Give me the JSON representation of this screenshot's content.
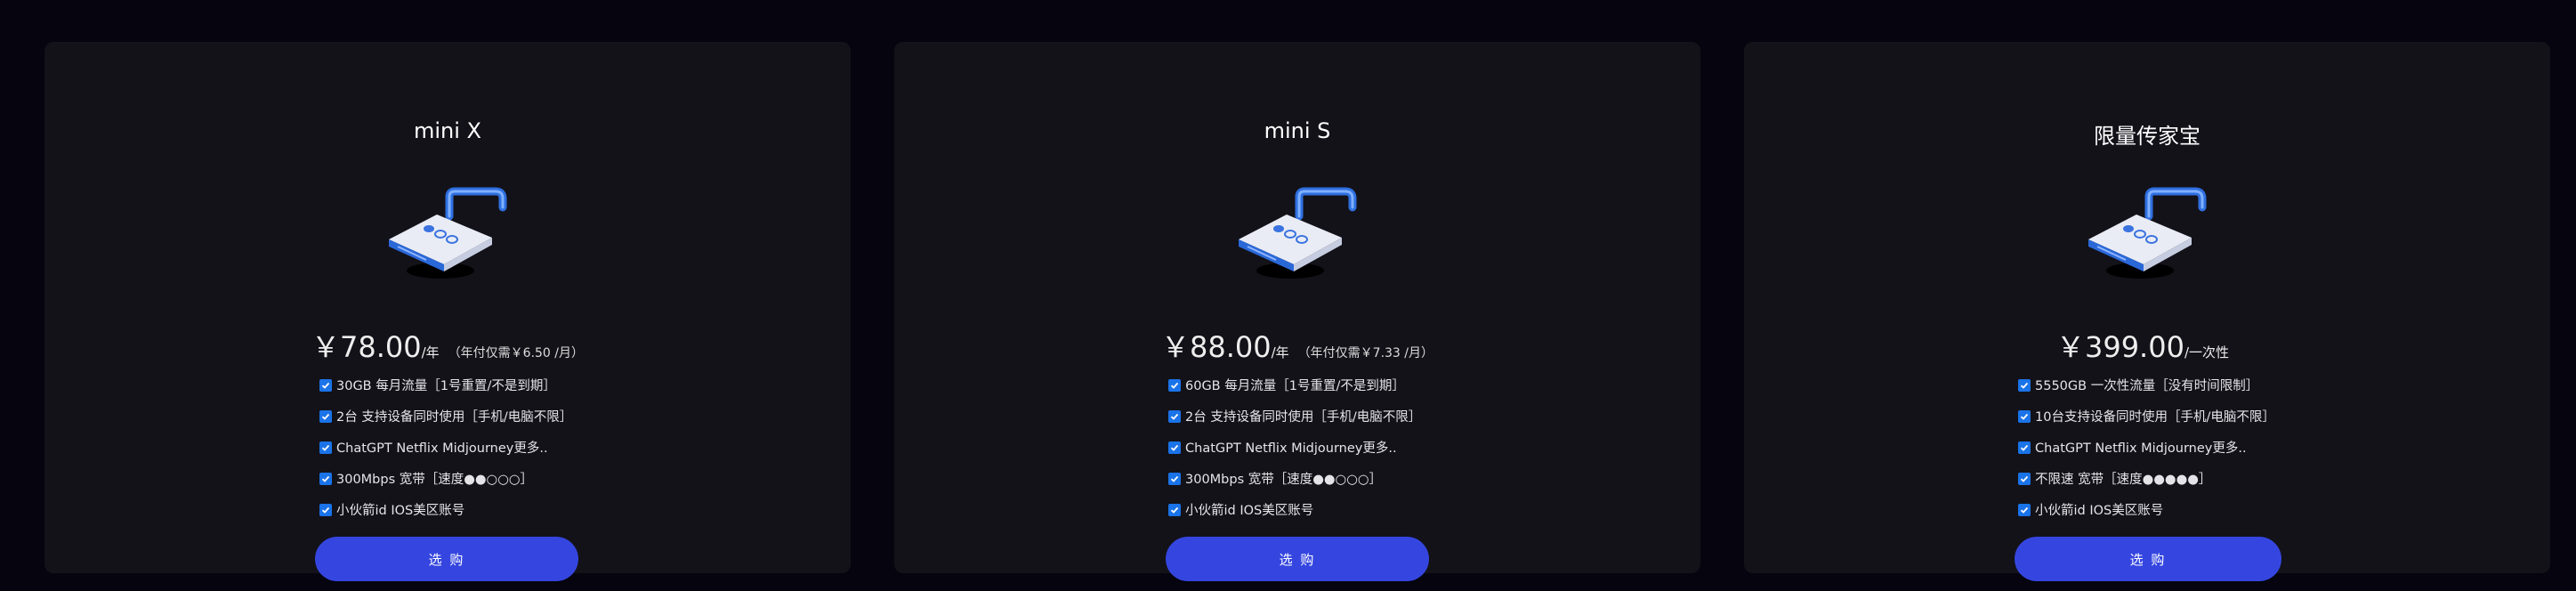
{
  "plans": [
    {
      "title": "mini X",
      "price": "￥78.00",
      "unit": "/年",
      "note": "（年付仅需￥6.50 /月）",
      "features": [
        "30GB 每月流量［1号重置/不是到期］",
        "2台 支持设备同时使用［手机/电脑不限］",
        "ChatGPT Netflix Midjourney更多..",
        "300Mbps 宽带［速度●●○○○］",
        "小伙箭id IOS美区账号"
      ],
      "button": "选 购"
    },
    {
      "title": "mini S",
      "price": "￥88.00",
      "unit": "/年",
      "note": "（年付仅需￥7.33 /月）",
      "features": [
        "60GB 每月流量［1号重置/不是到期］",
        "2台 支持设备同时使用［手机/电脑不限］",
        "ChatGPT Netflix Midjourney更多..",
        "300Mbps 宽带［速度●●○○○］",
        "小伙箭id IOS美区账号"
      ],
      "button": "选 购"
    },
    {
      "title": "限量传家宝",
      "price": "￥399.00",
      "unit": "/一次性",
      "note": "",
      "features": [
        "5550GB 一次性流量［没有时间限制］",
        "10台支持设备同时使用［手机/电脑不限］",
        "ChatGPT Netflix Midjourney更多..",
        "不限速 宽带［速度●●●●●］",
        "小伙箭id IOS美区账号"
      ],
      "button": "选 购"
    }
  ],
  "colors": {
    "page_bg": "#05040f",
    "card_bg": "#131219",
    "button": "#3546e0",
    "checkbox": "#1a73e8"
  },
  "icons": {
    "illustration": "padlock-drive-icon",
    "check": "checkbox-checked-icon"
  }
}
